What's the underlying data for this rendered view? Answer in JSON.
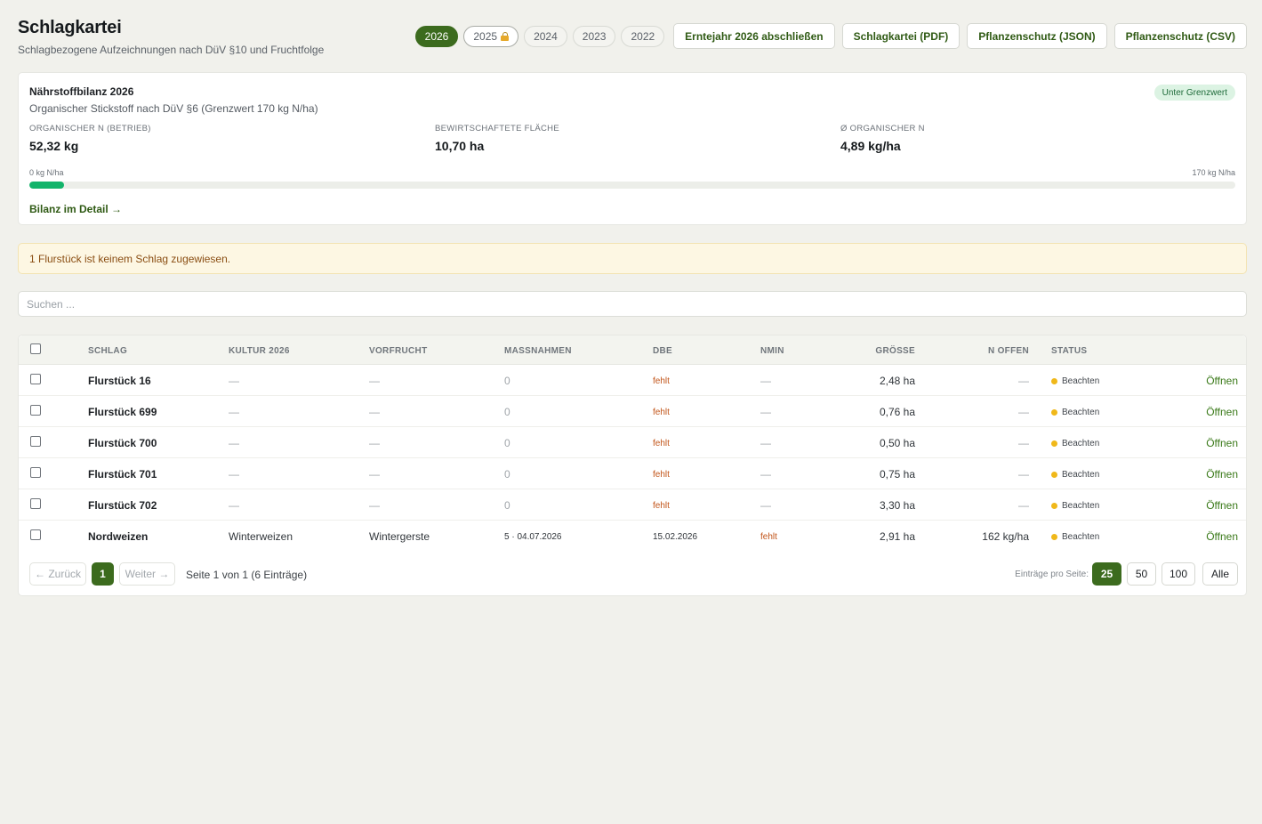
{
  "header": {
    "title": "Schlagkartei",
    "subtitle": "Schlagbezogene Aufzeichnungen nach DüV §10 und Fruchtfolge",
    "years": [
      {
        "label": "2026",
        "active": true,
        "locked": false
      },
      {
        "label": "2025",
        "active": false,
        "locked": true
      },
      {
        "label": "2024",
        "active": false,
        "locked": false
      },
      {
        "label": "2023",
        "active": false,
        "locked": false
      },
      {
        "label": "2022",
        "active": false,
        "locked": false
      }
    ],
    "actions": {
      "close_year": "Erntejahr 2026 abschließen",
      "export_pdf": "Schlagkartei (PDF)",
      "export_json": "Pflanzenschutz (JSON)",
      "export_csv": "Pflanzenschutz (CSV)"
    }
  },
  "balance": {
    "title": "Nährstoffbilanz 2026",
    "subtitle": "Organischer Stickstoff nach DüV §6 (Grenzwert 170 kg N/ha)",
    "badge": "Unter Grenzwert",
    "metrics": [
      {
        "label": "Organischer N (Betrieb)",
        "value": "52,32 kg"
      },
      {
        "label": "Bewirtschaftete Fläche",
        "value": "10,70 ha"
      },
      {
        "label": "Ø Organischer N",
        "value": "4,89 kg/ha"
      }
    ],
    "scale_min": "0 kg N/ha",
    "scale_max": "170 kg N/ha",
    "progress_fraction": 0.0288,
    "progress_color": "#12b46a",
    "detail_link": "Bilanz im Detail →"
  },
  "warning": {
    "text": "1 Flurstück ist keinem Schlag zugewiesen."
  },
  "search": {
    "placeholder": "Suchen ...",
    "value": ""
  },
  "table": {
    "headers": {
      "schlag": "SCHLAG",
      "kultur": "KULTUR 2026",
      "vorfrucht": "VORFRUCHT",
      "massnahmen": "MASSNAHMEN",
      "dbe": "DBE",
      "nmin": "NMIN",
      "groesse": "GRÖSSE",
      "n_offen": "N OFFEN",
      "status": "STATUS"
    },
    "open_label": "Öffnen",
    "rows": [
      {
        "schlag": "Flurstück 16",
        "kultur": "—",
        "vorfrucht": "—",
        "massnahmen": "0",
        "dbe": "fehlt",
        "nmin": "—",
        "groesse": "2,48 ha",
        "n_offen": "—",
        "status": "Beachten"
      },
      {
        "schlag": "Flurstück 699",
        "kultur": "—",
        "vorfrucht": "—",
        "massnahmen": "0",
        "dbe": "fehlt",
        "nmin": "—",
        "groesse": "0,76 ha",
        "n_offen": "—",
        "status": "Beachten"
      },
      {
        "schlag": "Flurstück 700",
        "kultur": "—",
        "vorfrucht": "—",
        "massnahmen": "0",
        "dbe": "fehlt",
        "nmin": "—",
        "groesse": "0,50 ha",
        "n_offen": "—",
        "status": "Beachten"
      },
      {
        "schlag": "Flurstück 701",
        "kultur": "—",
        "vorfrucht": "—",
        "massnahmen": "0",
        "dbe": "fehlt",
        "nmin": "—",
        "groesse": "0,75 ha",
        "n_offen": "—",
        "status": "Beachten"
      },
      {
        "schlag": "Flurstück 702",
        "kultur": "—",
        "vorfrucht": "—",
        "massnahmen": "0",
        "dbe": "fehlt",
        "nmin": "—",
        "groesse": "3,30 ha",
        "n_offen": "—",
        "status": "Beachten"
      },
      {
        "schlag": "Nordweizen",
        "kultur": "Winterweizen",
        "vorfrucht": "Wintergerste",
        "massnahmen": "5 · 04.07.2026",
        "dbe": "15.02.2026",
        "nmin": "fehlt",
        "groesse": "2,91 ha",
        "n_offen": "162 kg/ha",
        "status": "Beachten"
      }
    ]
  },
  "pagination": {
    "prev": "← Zurück",
    "page": "1",
    "next": "Weiter →",
    "info": "Seite 1 von 1 (6 Einträge)",
    "per_page_label": "Einträge pro Seite:",
    "per_page_options": [
      "25",
      "50",
      "100",
      "Alle"
    ],
    "per_page_selected": "25"
  }
}
